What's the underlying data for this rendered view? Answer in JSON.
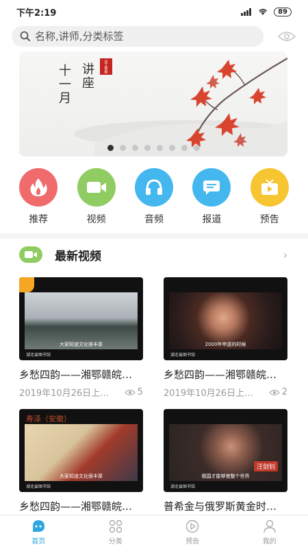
{
  "status": {
    "time": "下午2:19",
    "battery": "89"
  },
  "search": {
    "placeholder": "名称,讲师,分类标签"
  },
  "banner": {
    "title_a": "十一月",
    "title_b": "讲座",
    "seal_text": "长江新报"
  },
  "categories": [
    {
      "label": "推荐",
      "icon": "flame-icon",
      "color": "#f06b6b"
    },
    {
      "label": "视频",
      "icon": "video-camera-icon",
      "color": "#8fcc62"
    },
    {
      "label": "音频",
      "icon": "headphones-icon",
      "color": "#44b7ef"
    },
    {
      "label": "报道",
      "icon": "news-report-icon",
      "color": "#44b7ef"
    },
    {
      "label": "预告",
      "icon": "tv-icon",
      "color": "#f7c531"
    }
  ],
  "section": {
    "title": "最新视频",
    "more": "›"
  },
  "videos": [
    {
      "title": "乡愁四韵——湘鄂赣皖…",
      "date": "2019年10月26日上…",
      "views": "5",
      "caption": "大家知道文化很丰厚",
      "logo": "湖北省图书馆"
    },
    {
      "title": "乡愁四韵——湘鄂赣皖…",
      "date": "2019年10月26日上…",
      "views": "2",
      "caption": "2000年申遗的时候",
      "logo": "湖北省图书馆"
    },
    {
      "title": "乡愁四韵——湘鄂赣皖…",
      "caption": "大家知道文化很丰厚",
      "logo": "湖北省图书馆",
      "side_text": "寿泽（安徽）"
    },
    {
      "title": "普希金与俄罗斯黄金时…",
      "caption": "俄国才能够使整个世界",
      "logo": "湖北省图书馆",
      "name_tag": "汪剑钊"
    }
  ],
  "nav": [
    {
      "label": "首页",
      "icon": "home-icon",
      "active": true
    },
    {
      "label": "分类",
      "icon": "category-icon",
      "active": false
    },
    {
      "label": "预告",
      "icon": "play-circle-icon",
      "active": false
    },
    {
      "label": "我的",
      "icon": "user-icon",
      "active": false
    }
  ]
}
